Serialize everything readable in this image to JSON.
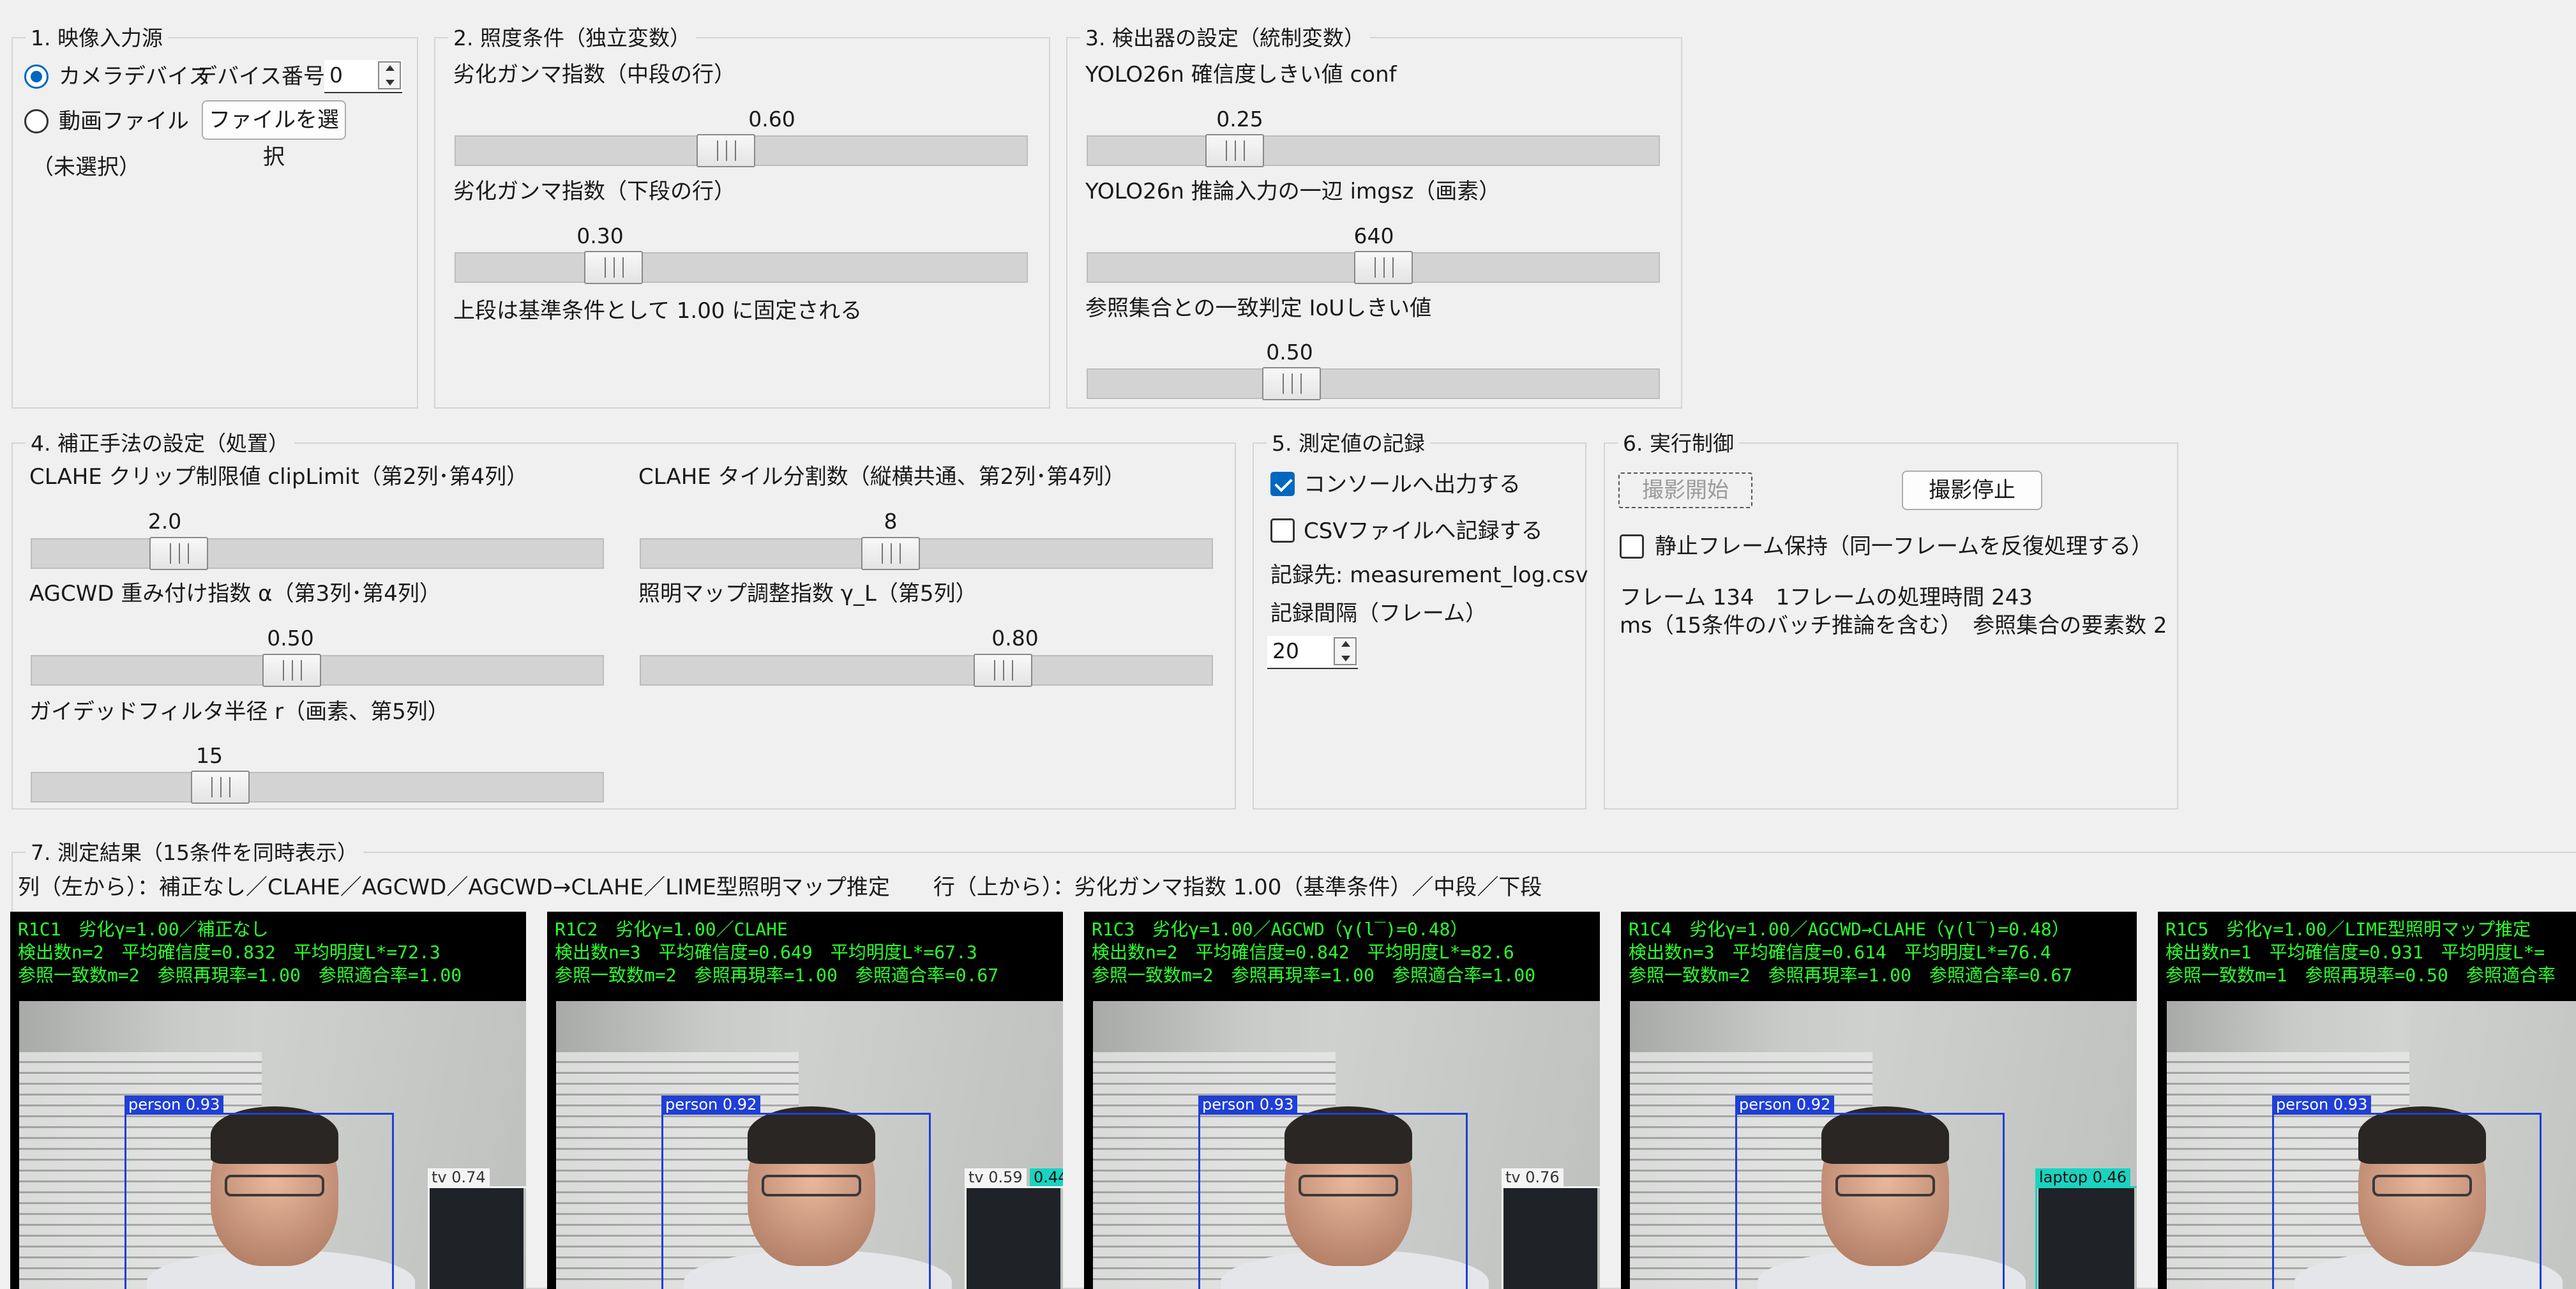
{
  "group1": {
    "title": "1. 映像入力源",
    "camera_label": "カメラデバイス",
    "device_label": "デバイス番号",
    "device_value": "0",
    "file_label": "動画ファイル",
    "file_button": "ファイルを選択",
    "file_status": "（未選択）"
  },
  "group2": {
    "title": "2. 照度条件（独立変数）",
    "mid_label": "劣化ガンマ指数（中段の行）",
    "mid_value": "0.60",
    "low_label": "劣化ガンマ指数（下段の行）",
    "low_value": "0.30",
    "note": "上段は基準条件として 1.00 に固定される",
    "mid_frac": 0.47,
    "low_frac": 0.25
  },
  "group3": {
    "title": "3. 検出器の設定（統制変数）",
    "conf_label": "YOLO26n 確信度しきい値 conf",
    "conf_value": "0.25",
    "imgsz_label": "YOLO26n 推論入力の一辺 imgsz（画素）",
    "imgsz_value": "640",
    "iou_label": "参照集合との一致判定 IoUしきい値",
    "iou_value": "0.50",
    "conf_frac": 0.23,
    "imgsz_frac": 0.52,
    "iou_frac": 0.34
  },
  "group4": {
    "title": "4. 補正手法の設定（処置）",
    "clip_label": "CLAHE クリップ制限値 clipLimit（第2列･第4列）",
    "clip_value": "2.0",
    "tile_label": "CLAHE タイル分割数（縦横共通、第2列･第4列）",
    "tile_value": "8",
    "alpha_label": "AGCWD 重み付け指数 α（第3列･第4列）",
    "alpha_value": "0.50",
    "gamma_label": "照明マップ調整指数 γ_L（第5列）",
    "gamma_value": "0.80",
    "radius_label": "ガイデッドフィルタ半径 r（画素、第5列）",
    "radius_value": "15",
    "clip_frac": 0.23,
    "tile_frac": 0.43,
    "alpha_frac": 0.45,
    "gamma_frac": 0.65,
    "radius_frac": 0.31
  },
  "group5": {
    "title": "5. 測定値の記録",
    "console_label": "コンソールへ出力する",
    "csv_label": "CSVファイルへ記録する",
    "dest_label": "記録先: measurement_log.csv",
    "interval_label": "記録間隔（フレーム）",
    "interval_value": "20"
  },
  "group6": {
    "title": "6. 実行制御",
    "start_button": "撮影開始",
    "stop_button": "撮影停止",
    "hold_label": "静止フレーム保持（同一フレームを反復処理する）",
    "status_line1": "フレーム 134　1フレームの処理時間 243",
    "status_line2": "ms（15条件のバッチ推論を含む）　参照集合の要素数 2"
  },
  "group7": {
    "title": "7. 測定結果（15条件を同時表示）",
    "legend": "列（左から）：補正なし／CLAHE／AGCWD／AGCWD→CLAHE／LIME型照明マップ推定　　行（上から）：劣化ガンマ指数 1.00（基準条件）／中段／下段"
  },
  "panels": [
    {
      "line1": "R1C1　劣化γ=1.00／補正なし",
      "line2": "検出数n=2　平均確信度=0.832　平均明度L*=72.3",
      "line3": "参照一致数m=2　参照再現率=1.00　参照適合率=1.00",
      "box1_label": "person 0.93",
      "box2_label": "tv 0.74"
    },
    {
      "line1": "R1C2　劣化γ=1.00／CLAHE",
      "line2": "検出数n=3　平均確信度=0.649　平均明度L*=67.3",
      "line3": "参照一致数m=2　参照再現率=1.00　参照適合率=0.67",
      "box1_label": "person 0.92",
      "box2_label": "tv 0.59",
      "box3_label": "0.44"
    },
    {
      "line1": "R1C3　劣化γ=1.00／AGCWD（γ(l‾)=0.48）",
      "line2": "検出数n=2　平均確信度=0.842　平均明度L*=82.6",
      "line3": "参照一致数m=2　参照再現率=1.00　参照適合率=1.00",
      "box1_label": "person 0.93",
      "box2_label": "tv 0.76"
    },
    {
      "line1": "R1C4　劣化γ=1.00／AGCWD→CLAHE（γ(l‾)=0.48）",
      "line2": "検出数n=3　平均確信度=0.614　平均明度L*=76.4",
      "line3": "参照一致数m=2　参照再現率=1.00　参照適合率=0.67",
      "box1_label": "person 0.92",
      "box2_label": "laptop 0.46"
    },
    {
      "line1": "R1C5　劣化γ=1.00／LIME型照明マップ推定",
      "line2": "検出数n=1　平均確信度=0.931　平均明度L*=",
      "line3": "参照一致数m=1　参照再現率=0.50　参照適合率",
      "box1_label": "person 0.93"
    }
  ]
}
